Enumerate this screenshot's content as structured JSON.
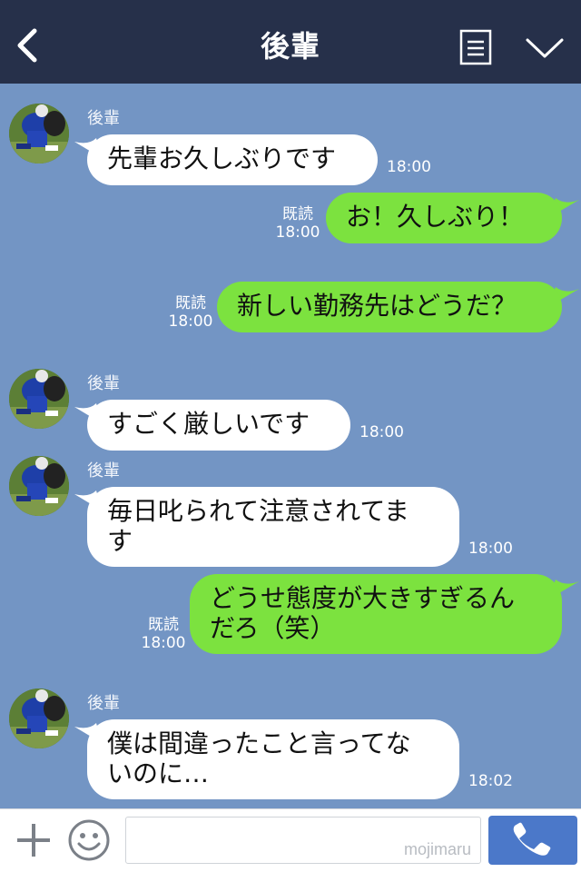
{
  "header": {
    "title": "後輩",
    "back_icon": "chevron-left-icon",
    "menu_icon": "note-icon",
    "collapse_icon": "chevron-down-icon"
  },
  "messages": [
    {
      "dir": "in",
      "sender": "後輩",
      "text": "先輩お久しぶりです",
      "time": "18:00"
    },
    {
      "dir": "out",
      "read": "既読",
      "text": "お！久しぶり！",
      "time": "18:00"
    },
    {
      "dir": "out",
      "read": "既読",
      "text": "新しい勤務先はどうだ？",
      "time": "18:00"
    },
    {
      "dir": "in",
      "sender": "後輩",
      "text": "すごく厳しいです",
      "time": "18:00"
    },
    {
      "dir": "in",
      "sender": "後輩",
      "text": "毎日叱られて注意されてま\nす",
      "time": "18:00"
    },
    {
      "dir": "out",
      "read": "既読",
      "text": "どうせ態度が大きすぎるん\nだろ（笑）",
      "time": "18:00"
    },
    {
      "dir": "in",
      "sender": "後輩",
      "text": "僕は間違ったこと言ってな\nいのに…",
      "time": "18:02"
    }
  ],
  "footer": {
    "plus_icon": "plus-icon",
    "emoji_icon": "smiley-icon",
    "input_value": "",
    "watermark": "mojimaru",
    "call_icon": "phone-icon"
  },
  "colors": {
    "background": "#7395c4",
    "header": "#26304a",
    "incoming_bubble": "#ffffff",
    "outgoing_bubble": "#7ce23f",
    "call_button": "#4b78c9"
  }
}
